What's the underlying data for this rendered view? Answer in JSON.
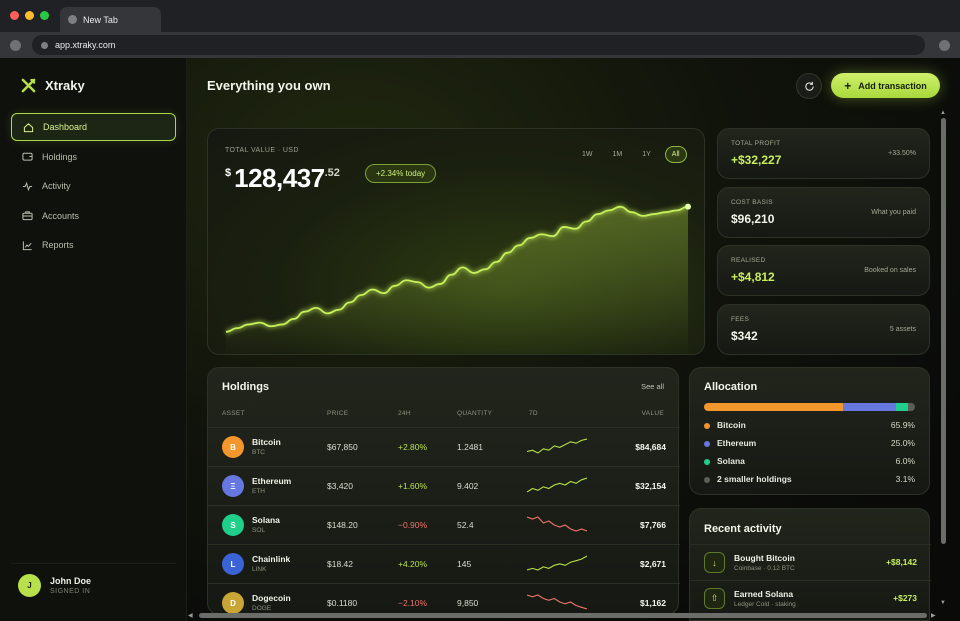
{
  "browser": {
    "tab_title": "New Tab",
    "url": "app.xtraky.com",
    "traffic_lights": [
      "#ff5f57",
      "#febc2e",
      "#28c840"
    ]
  },
  "brand": {
    "name": "Xtraky",
    "accent": "#b8e04a"
  },
  "sidebar": {
    "items": [
      {
        "label": "Dashboard",
        "icon": "home-icon",
        "active": true
      },
      {
        "label": "Holdings",
        "icon": "wallet-icon",
        "active": false
      },
      {
        "label": "Activity",
        "icon": "activity-icon",
        "active": false
      },
      {
        "label": "Accounts",
        "icon": "briefcase-icon",
        "active": false
      },
      {
        "label": "Reports",
        "icon": "chart-icon",
        "active": false
      }
    ]
  },
  "user": {
    "initial": "J",
    "name": "John Doe",
    "status": "SIGNED IN"
  },
  "header": {
    "title": "Everything you own",
    "add_button": "Add transaction"
  },
  "portfolio": {
    "label": "TOTAL VALUE · USD",
    "currency": "$",
    "value": "128,437",
    "cents": ".52",
    "change": "+2.34% today",
    "ranges": [
      "1W",
      "1M",
      "1Y",
      "All"
    ],
    "active_range": "All"
  },
  "chart_data": {
    "type": "line",
    "title": "",
    "xlabel": "",
    "ylabel": "",
    "x": [
      0,
      1,
      2,
      3,
      4,
      5,
      6,
      7,
      8,
      9,
      10,
      11,
      12,
      13,
      14,
      15,
      16,
      17,
      18,
      19,
      20,
      21,
      22,
      23,
      24,
      25,
      26,
      27,
      28,
      29,
      30,
      31,
      32,
      33,
      34,
      35,
      36,
      37,
      38,
      39,
      40,
      41
    ],
    "series": [
      {
        "values": [
          10,
          14,
          18,
          20,
          16,
          18,
          24,
          32,
          36,
          30,
          34,
          42,
          50,
          56,
          52,
          60,
          66,
          64,
          58,
          62,
          72,
          80,
          74,
          78,
          86,
          96,
          104,
          112,
          116,
          114,
          124,
          122,
          130,
          138,
          142,
          146,
          140,
          136,
          138,
          140,
          142,
          146
        ]
      }
    ],
    "grid": false,
    "legend": "none"
  },
  "stats": [
    {
      "label": "TOTAL PROFIT",
      "value": "+$32,227",
      "note": "+33.50%",
      "positive": true
    },
    {
      "label": "COST BASIS",
      "value": "$96,210",
      "note": "What you paid",
      "positive": false
    },
    {
      "label": "REALISED",
      "value": "+$4,812",
      "note": "Booked on sales",
      "positive": true
    },
    {
      "label": "FEES",
      "value": "$342",
      "note": "5 assets",
      "positive": false
    }
  ],
  "holdings": {
    "title": "Holdings",
    "see_all": "See all",
    "columns": [
      "ASSET",
      "PRICE",
      "24H",
      "QUANTITY",
      "7D",
      "VALUE"
    ],
    "rows": [
      {
        "symbol_glyph": "B",
        "name": "Bitcoin",
        "ticker": "BTC",
        "price": "$67,850",
        "change": "+2.80%",
        "up": true,
        "qty": "1.2481",
        "value": "$84,684",
        "color": "#f3962b",
        "trend": [
          8,
          9,
          7,
          10,
          9,
          12,
          11,
          13,
          15,
          14,
          16,
          17
        ]
      },
      {
        "symbol_glyph": "Ξ",
        "name": "Ethereum",
        "ticker": "ETH",
        "price": "$3,420",
        "change": "+1.60%",
        "up": true,
        "qty": "9.402",
        "value": "$32,154",
        "color": "#6677e0",
        "trend": [
          6,
          8,
          7,
          9,
          8,
          10,
          11,
          10,
          12,
          11,
          13,
          14
        ]
      },
      {
        "symbol_glyph": "S",
        "name": "Solana",
        "ticker": "SOL",
        "price": "$148.20",
        "change": "−0.90%",
        "up": false,
        "qty": "52.4",
        "value": "$7,766",
        "color": "#1fcf8a",
        "trend": [
          15,
          14,
          15,
          12,
          13,
          11,
          10,
          11,
          9,
          8,
          9,
          8
        ]
      },
      {
        "symbol_glyph": "L",
        "name": "Chainlink",
        "ticker": "LINK",
        "price": "$18.42",
        "change": "+4.20%",
        "up": true,
        "qty": "145",
        "value": "$2,671",
        "color": "#3a63d8",
        "trend": [
          6,
          7,
          6,
          8,
          7,
          9,
          10,
          9,
          11,
          12,
          13,
          15
        ]
      },
      {
        "symbol_glyph": "D",
        "name": "Dogecoin",
        "ticker": "DOGE",
        "price": "$0.1180",
        "change": "−2.10%",
        "up": false,
        "qty": "9,850",
        "value": "$1,162",
        "color": "#c9a535",
        "trend": [
          15,
          14,
          15,
          13,
          12,
          13,
          11,
          10,
          11,
          9,
          8,
          7
        ]
      }
    ]
  },
  "allocation": {
    "title": "Allocation",
    "items": [
      {
        "label": "Bitcoin",
        "pct": "65.9%",
        "share": 65.9,
        "color": "#f3962b"
      },
      {
        "label": "Ethereum",
        "pct": "25.0%",
        "share": 25.0,
        "color": "#6677e0"
      },
      {
        "label": "Solana",
        "pct": "6.0%",
        "share": 6.0,
        "color": "#1fcf8a"
      },
      {
        "label": "2 smaller holdings",
        "pct": "3.1%",
        "share": 3.1,
        "color": "#5a5e55"
      }
    ]
  },
  "activity": {
    "title": "Recent activity",
    "items": [
      {
        "icon": "download-icon",
        "glyph": "↓",
        "title": "Bought Bitcoin",
        "sub": "Coinbase · 0.12 BTC",
        "amount": "+$8,142"
      },
      {
        "icon": "stake-icon",
        "glyph": "⇧",
        "title": "Earned Solana",
        "sub": "Ledger Cold · staking",
        "amount": "+$273"
      }
    ]
  }
}
